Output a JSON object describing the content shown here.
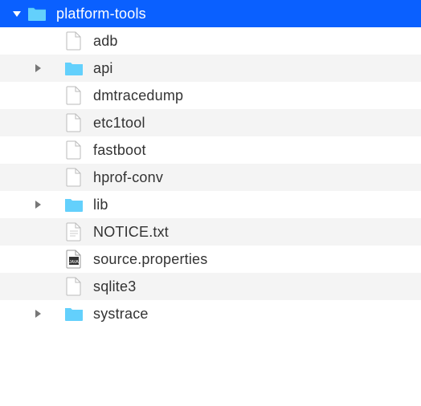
{
  "tree": {
    "root": {
      "name": "platform-tools",
      "kind": "folder",
      "expanded": true,
      "selected": true,
      "depth": 0
    },
    "children": [
      {
        "name": "adb",
        "kind": "file",
        "depth": 1,
        "alt": false
      },
      {
        "name": "api",
        "kind": "folder",
        "expanded": false,
        "depth": 1,
        "alt": true
      },
      {
        "name": "dmtracedump",
        "kind": "file",
        "depth": 1,
        "alt": false
      },
      {
        "name": "etc1tool",
        "kind": "file",
        "depth": 1,
        "alt": true
      },
      {
        "name": "fastboot",
        "kind": "file",
        "depth": 1,
        "alt": false
      },
      {
        "name": "hprof-conv",
        "kind": "file",
        "depth": 1,
        "alt": true
      },
      {
        "name": "lib",
        "kind": "folder",
        "expanded": false,
        "depth": 1,
        "alt": false
      },
      {
        "name": "NOTICE.txt",
        "kind": "textfile",
        "depth": 1,
        "alt": true
      },
      {
        "name": "source.properties",
        "kind": "javafile",
        "depth": 1,
        "alt": false
      },
      {
        "name": "sqlite3",
        "kind": "file",
        "depth": 1,
        "alt": true
      },
      {
        "name": "systrace",
        "kind": "folder",
        "expanded": false,
        "depth": 1,
        "alt": false
      }
    ]
  },
  "colors": {
    "selection": "#0a60ff",
    "folder": "#63d0fc",
    "alt_row": "#f4f4f4"
  }
}
